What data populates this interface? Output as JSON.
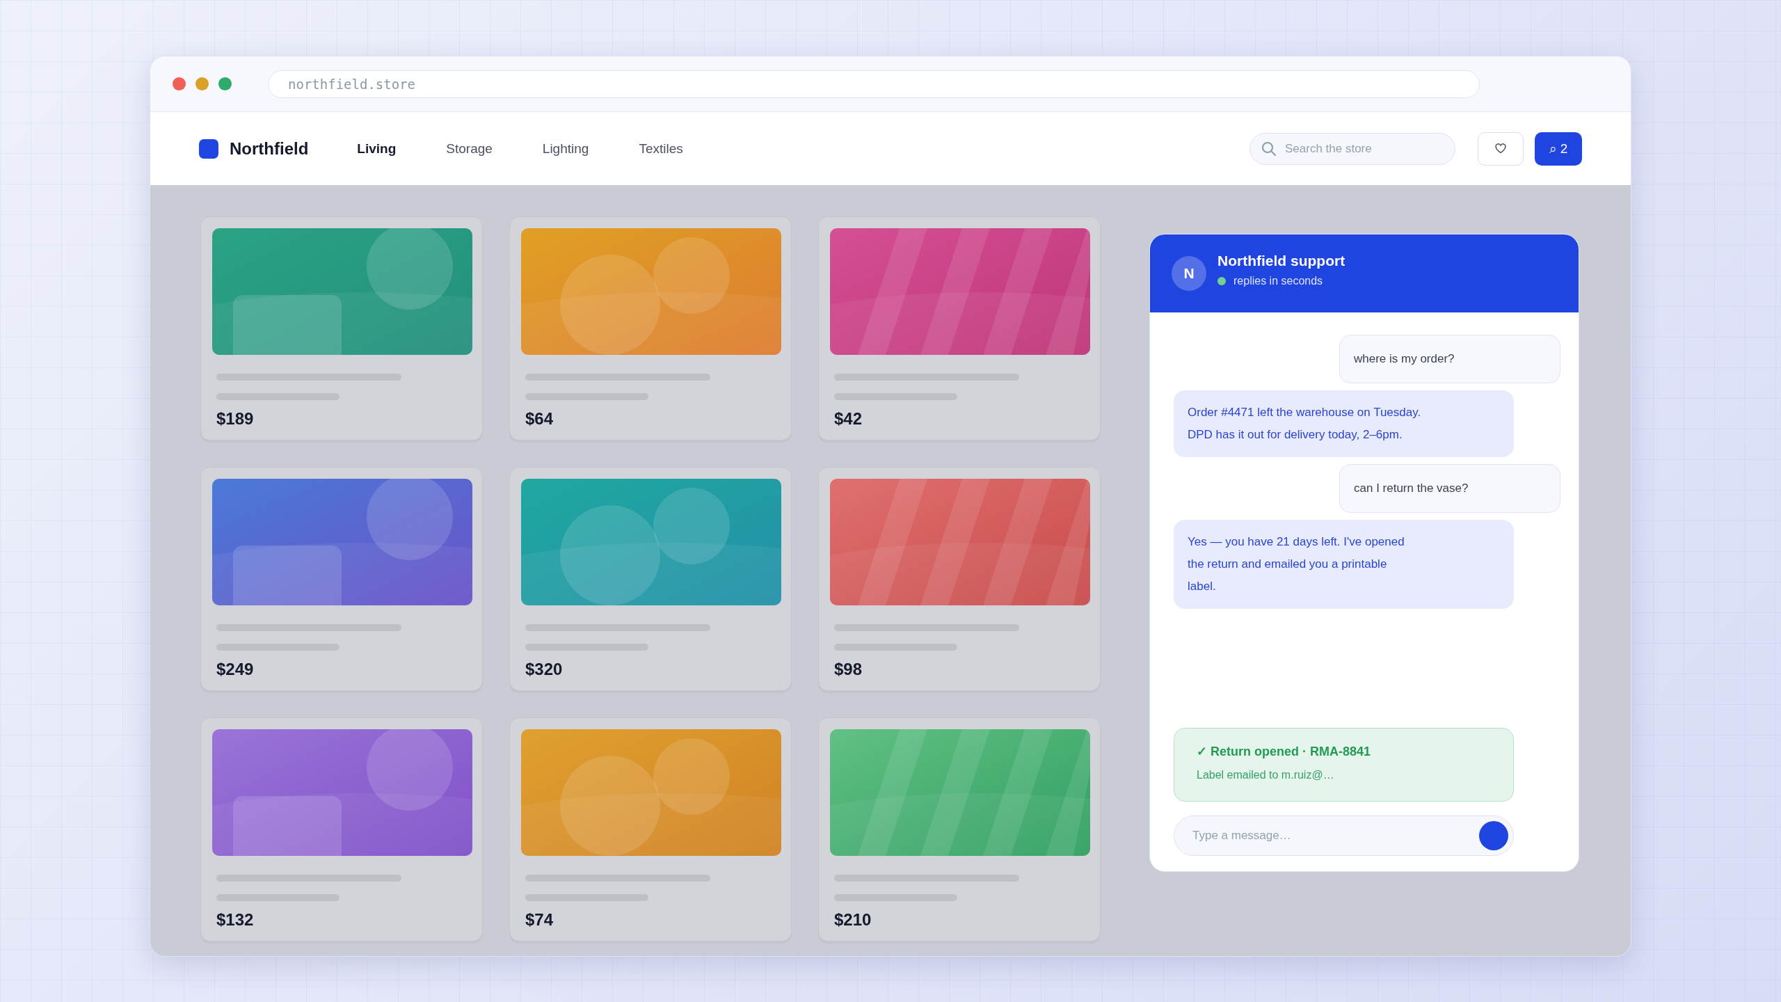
{
  "browser": {
    "url": "northfield.store"
  },
  "nav": {
    "brand": "Northfield",
    "tabs": [
      {
        "label": "Living",
        "selected": true
      },
      {
        "label": "Storage",
        "selected": false
      },
      {
        "label": "Lighting",
        "selected": false
      },
      {
        "label": "Textiles",
        "selected": false
      }
    ],
    "search": {
      "placeholder": "Search the store"
    },
    "cart_button": {
      "label": "⌕ 2"
    }
  },
  "products": [
    {
      "price": "$189"
    },
    {
      "price": "$64"
    },
    {
      "price": "$42"
    },
    {
      "price": "$249"
    },
    {
      "price": "$320"
    },
    {
      "price": "$98"
    },
    {
      "price": "$132"
    },
    {
      "price": "$74"
    },
    {
      "price": "$210"
    }
  ],
  "chat": {
    "avatar": "N",
    "title": "Northfield support",
    "status": "replies in seconds",
    "online": true,
    "messages": [
      {
        "kind": "user",
        "text": "where is my order?"
      },
      {
        "kind": "agent",
        "text": "Order #4471 left the warehouse on Tuesday.\nDPD has it out for delivery today, 2–6pm."
      },
      {
        "kind": "user",
        "text": "can I return the vase?"
      },
      {
        "kind": "agent",
        "text": "Yes — you have 21 days left. I've opened\nthe return and emailed you a printable\nlabel."
      }
    ],
    "notice": {
      "title": "✓ Return opened · RMA-8841",
      "detail": "Label emailed to m.ruiz@…"
    },
    "input": {
      "placeholder": "Type a message…"
    }
  }
}
